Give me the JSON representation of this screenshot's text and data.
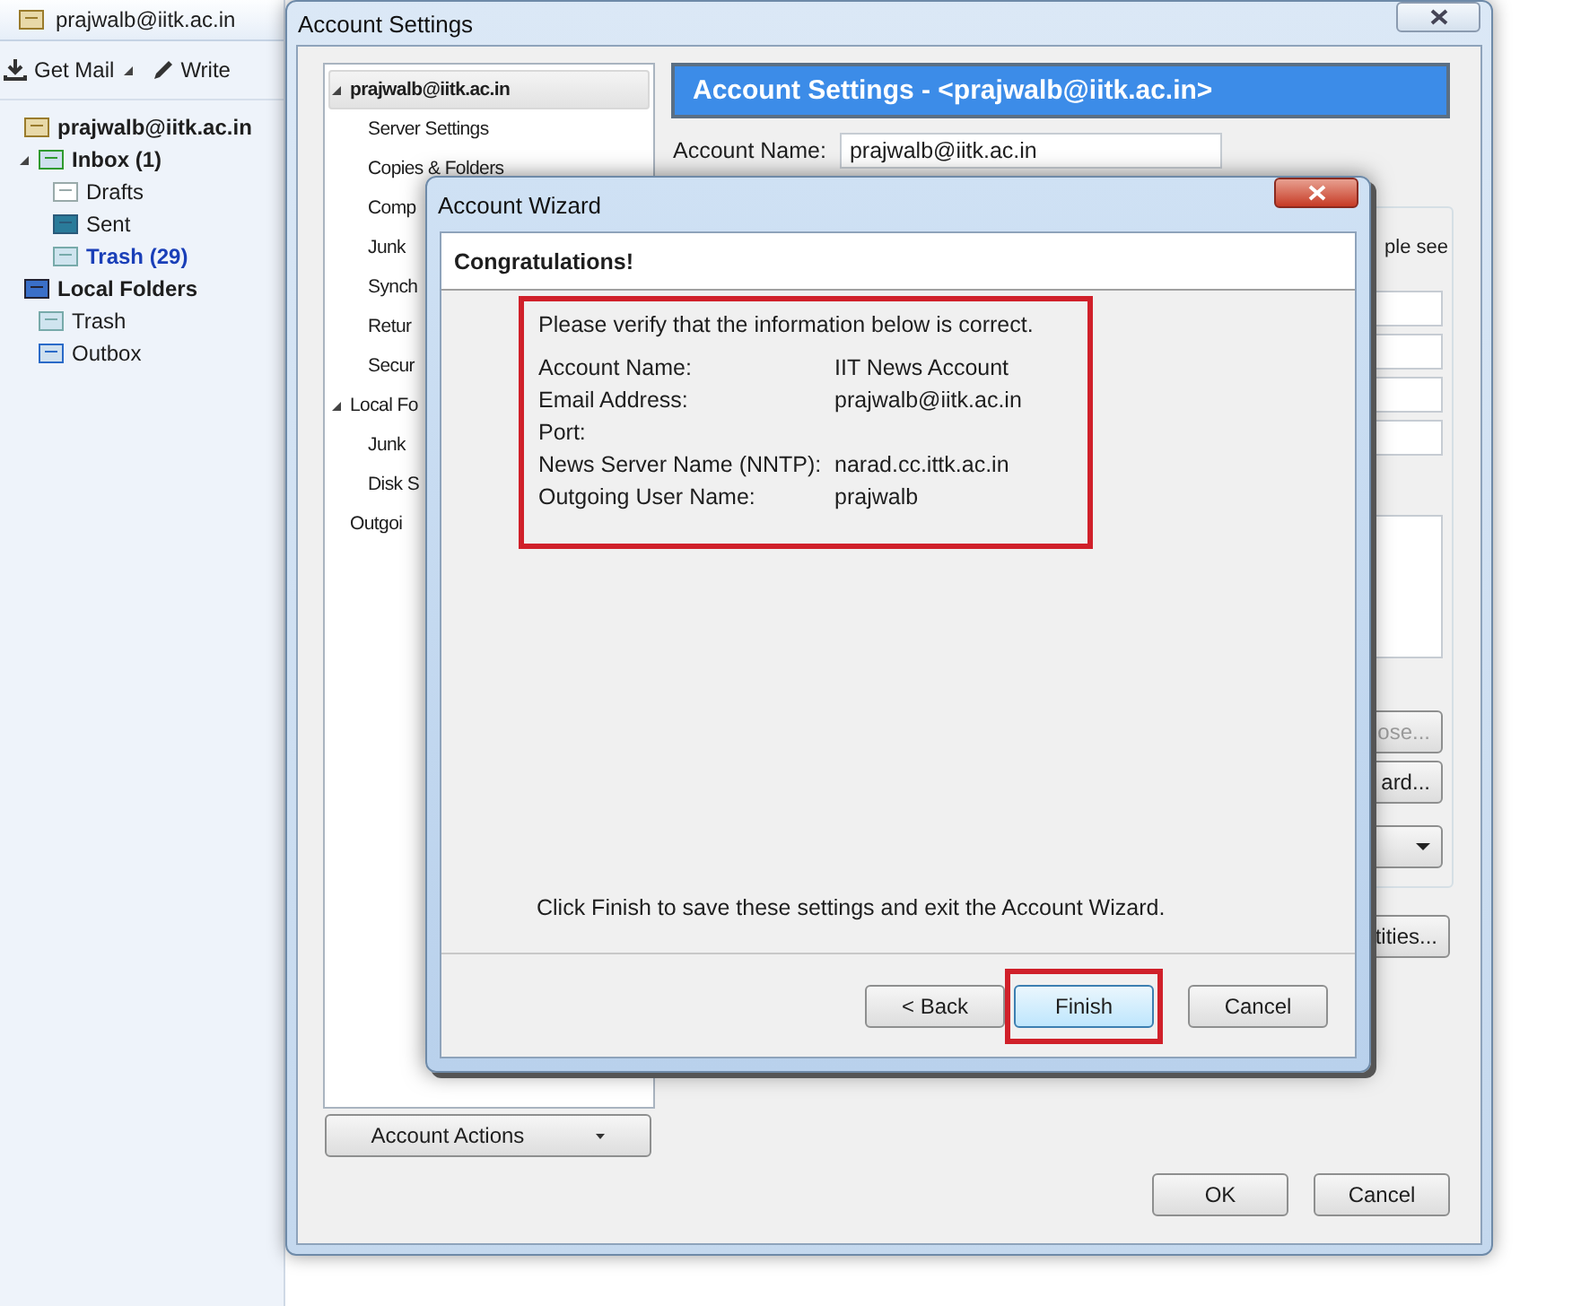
{
  "mail_app": {
    "tab": {
      "label": "prajwalb@iitk.ac.in"
    },
    "toolbar": [
      {
        "label": "Get Mail",
        "kind": "get"
      },
      {
        "label": "Write",
        "kind": "write"
      }
    ],
    "folders": [
      {
        "label": "prajwalb@iitk.ac.in",
        "kind": "account",
        "unread": true,
        "new": false,
        "children": [
          {
            "label": "Inbox (1)",
            "kind": "inbox",
            "unread": true,
            "new": false,
            "expanded": true,
            "children": [
              {
                "label": "Drafts",
                "kind": "drafts",
                "unread": false,
                "new": false
              },
              {
                "label": "Sent",
                "kind": "sent",
                "unread": false,
                "new": false
              },
              {
                "label": "Trash (29)",
                "kind": "trash",
                "unread": true,
                "new": true
              }
            ]
          }
        ]
      },
      {
        "label": "Local Folders",
        "kind": "local",
        "unread": true,
        "new": false,
        "children": [
          {
            "label": "Trash",
            "kind": "trash",
            "unread": false,
            "new": false
          },
          {
            "label": "Outbox",
            "kind": "outbox",
            "unread": false,
            "new": false
          }
        ]
      }
    ]
  },
  "settings_window": {
    "title": "Account Settings",
    "tree": [
      {
        "label": "prajwalb@iitk.ac.in",
        "selected": true,
        "expanded": true,
        "children": [
          {
            "label": "Server Settings",
            "selected": false
          },
          {
            "label": "Copies & Folders",
            "selected": false
          },
          {
            "label": "Comp",
            "selected": false
          },
          {
            "label": "Junk",
            "selected": false
          },
          {
            "label": "Synch",
            "selected": false
          },
          {
            "label": "Retur",
            "selected": false
          },
          {
            "label": "Secur",
            "selected": false
          }
        ]
      },
      {
        "label": "Local Fo",
        "selected": false,
        "expanded": true,
        "children": [
          {
            "label": "Junk",
            "selected": false
          },
          {
            "label": "Disk S",
            "selected": false
          }
        ]
      },
      {
        "label": "Outgoi",
        "selected": false
      }
    ],
    "account_actions": "Account Actions",
    "header": "Account Settings - <prajwalb@iitk.ac.in>",
    "account_name": {
      "label": "Account Name:",
      "value": "prajwalb@iitk.ac.in"
    },
    "identity": {
      "note": "ple see",
      "buttons": [
        {
          "label": "ose...",
          "disabled": true
        },
        {
          "label": "ard...",
          "disabled": false
        }
      ]
    },
    "identities_button": "tities...",
    "buttons": [
      "OK",
      "Cancel"
    ]
  },
  "wizard": {
    "title": "Account Wizard",
    "heading": "Congratulations!",
    "intro": "Please verify that the information below is correct.",
    "rows": [
      {
        "label": "Account Name:",
        "value": "IIT News Account"
      },
      {
        "label": "Email Address:",
        "value": "prajwalb@iitk.ac.in"
      },
      {
        "label": "Port:"
      },
      {
        "label": "News Server Name (NNTP):",
        "value": "narad.cc.ittk.ac.in"
      },
      {
        "label": "Outgoing User Name:",
        "value": "prajwalb"
      }
    ],
    "footer": "Click Finish to save these settings and exit the Account Wizard.",
    "buttons": [
      {
        "label": "< Back",
        "default": false,
        "marked": false
      },
      {
        "label": "Finish",
        "default": true,
        "marked": true
      },
      {
        "label": "Cancel",
        "default": false,
        "marked": false
      }
    ]
  }
}
